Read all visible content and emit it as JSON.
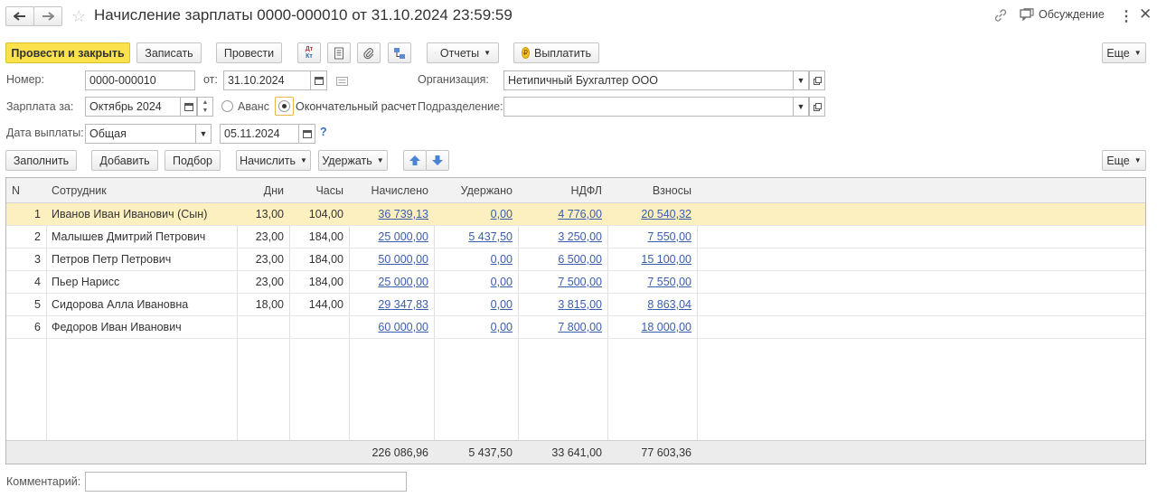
{
  "window": {
    "title": "Начисление зарплаты 0000-000010 от 31.10.2024 23:59:59",
    "discussion_label": "Обсуждение"
  },
  "toolbar": {
    "post_close_label": "Провести и закрыть",
    "save_label": "Записать",
    "post_label": "Провести",
    "dtkt_label": "Дт Кт",
    "reports_label": "Отчеты",
    "pay_label": "Выплатить",
    "more_label": "Еще"
  },
  "form": {
    "number_label": "Номер:",
    "number_value": "0000-000010",
    "date_label": "от:",
    "date_value": "31.10.2024",
    "org_label": "Организация:",
    "org_value": "Нетипичный Бухгалтер ООО",
    "salary_for_label": "Зарплата за:",
    "salary_for_value": "Октябрь 2024",
    "advance_label": "Аванс",
    "final_label": "Окончательный расчет",
    "division_label": "Подразделение:",
    "division_value": "",
    "pay_date_label": "Дата выплаты:",
    "pay_date_type": "Общая",
    "pay_date_value": "05.11.2024",
    "help_label": "?",
    "comment_label": "Комментарий:",
    "comment_value": ""
  },
  "table_toolbar": {
    "fill_label": "Заполнить",
    "add_label": "Добавить",
    "select_label": "Подбор",
    "accrue_label": "Начислить",
    "withhold_label": "Удержать",
    "more_label": "Еще"
  },
  "table": {
    "columns": [
      "N",
      "Сотрудник",
      "Дни",
      "Часы",
      "Начислено",
      "Удержано",
      "НДФЛ",
      "Взносы"
    ],
    "rows": [
      {
        "n": "1",
        "employee": "Иванов Иван Иванович (Сын)",
        "days": "13,00",
        "hours": "104,00",
        "accrued": "36 739,13",
        "withheld": "0,00",
        "ndfl": "4 776,00",
        "contrib": "20 540,32"
      },
      {
        "n": "2",
        "employee": "Малышев Дмитрий Петрович",
        "days": "23,00",
        "hours": "184,00",
        "accrued": "25 000,00",
        "withheld": "5 437,50",
        "ndfl": "3 250,00",
        "contrib": "7 550,00"
      },
      {
        "n": "3",
        "employee": "Петров Петр Петрович",
        "days": "23,00",
        "hours": "184,00",
        "accrued": "50 000,00",
        "withheld": "0,00",
        "ndfl": "6 500,00",
        "contrib": "15 100,00"
      },
      {
        "n": "4",
        "employee": "Пьер Нарисс",
        "days": "23,00",
        "hours": "184,00",
        "accrued": "25 000,00",
        "withheld": "0,00",
        "ndfl": "7 500,00",
        "contrib": "7 550,00"
      },
      {
        "n": "5",
        "employee": "Сидорова Алла Ивановна",
        "days": "18,00",
        "hours": "144,00",
        "accrued": "29 347,83",
        "withheld": "0,00",
        "ndfl": "3 815,00",
        "contrib": "8 863,04"
      },
      {
        "n": "6",
        "employee": "Федоров Иван Иванович",
        "days": "",
        "hours": "",
        "accrued": "60 000,00",
        "withheld": "0,00",
        "ndfl": "7 800,00",
        "contrib": "18 000,00"
      }
    ],
    "totals": {
      "accrued": "226 086,96",
      "withheld": "5 437,50",
      "ndfl": "33 641,00",
      "contrib": "77 603,36"
    }
  },
  "colors": {
    "primary_button": "#fbe24c",
    "selected_row": "#fdf0c0",
    "link": "#3a5dae"
  }
}
